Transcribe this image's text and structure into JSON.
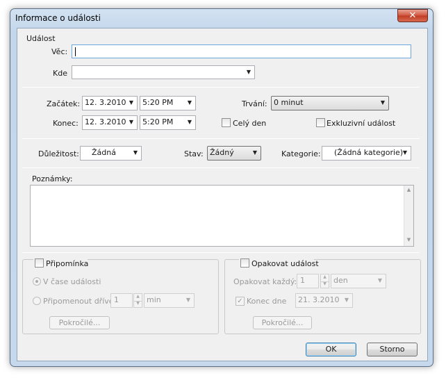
{
  "window": {
    "title": "Informace o události",
    "close_glyph": "✕"
  },
  "event": {
    "group_label": "Událost",
    "subject_label": "Věc:",
    "subject_value": "",
    "location_label": "Kde",
    "location_value": ""
  },
  "time": {
    "start_label": "Začátek:",
    "start_date": "12.  3.2010",
    "start_time": "5:20 PM",
    "end_label": "Konec:",
    "end_date": "12.  3.2010",
    "end_time": "5:20 PM",
    "duration_label": "Trvání:",
    "duration_value": "0 minut",
    "all_day_label": "Celý den",
    "exclusive_label": "Exkluzivní událost"
  },
  "props": {
    "importance_label": "Důležitost:",
    "importance_value": "Žádná",
    "status_label": "Stav:",
    "status_value": "Žádný",
    "category_label": "Kategorie:",
    "category_value": "(Žádná kategorie)"
  },
  "notes": {
    "label": "Poznámky:",
    "value": ""
  },
  "reminder": {
    "checkbox_label": "Připomínka",
    "at_time_label": "V čase události",
    "before_label": "Připomenout dříve",
    "before_value": "1",
    "unit_value": "min",
    "advanced_label": "Pokročilé..."
  },
  "repeat": {
    "checkbox_label": "Opakovat událost",
    "every_label": "Opakovat každý:",
    "every_value": "1",
    "unit_value": "den",
    "end_label": "Konec dne",
    "end_date": "21.  3.2010",
    "advanced_label": "Pokročilé..."
  },
  "buttons": {
    "ok": "OK",
    "cancel": "Storno"
  },
  "icons": {
    "dropdown": "▼",
    "scroll_up": "▲",
    "scroll_down": "▼",
    "check": "✓"
  }
}
